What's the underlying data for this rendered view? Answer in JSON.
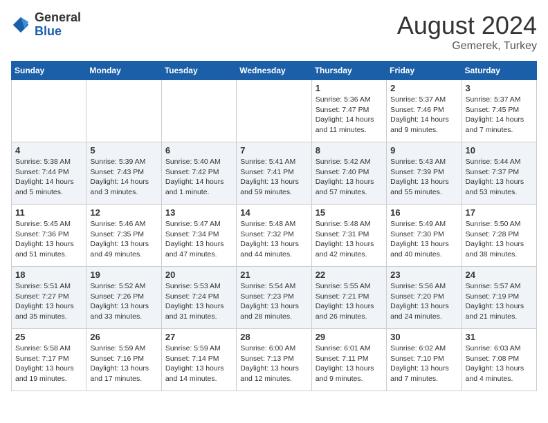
{
  "logo": {
    "general": "General",
    "blue": "Blue"
  },
  "title": {
    "month_year": "August 2024",
    "location": "Gemerek, Turkey"
  },
  "weekdays": [
    "Sunday",
    "Monday",
    "Tuesday",
    "Wednesday",
    "Thursday",
    "Friday",
    "Saturday"
  ],
  "weeks": [
    [
      {
        "day": "",
        "info": ""
      },
      {
        "day": "",
        "info": ""
      },
      {
        "day": "",
        "info": ""
      },
      {
        "day": "",
        "info": ""
      },
      {
        "day": "1",
        "info": "Sunrise: 5:36 AM\nSunset: 7:47 PM\nDaylight: 14 hours\nand 11 minutes."
      },
      {
        "day": "2",
        "info": "Sunrise: 5:37 AM\nSunset: 7:46 PM\nDaylight: 14 hours\nand 9 minutes."
      },
      {
        "day": "3",
        "info": "Sunrise: 5:37 AM\nSunset: 7:45 PM\nDaylight: 14 hours\nand 7 minutes."
      }
    ],
    [
      {
        "day": "4",
        "info": "Sunrise: 5:38 AM\nSunset: 7:44 PM\nDaylight: 14 hours\nand 5 minutes."
      },
      {
        "day": "5",
        "info": "Sunrise: 5:39 AM\nSunset: 7:43 PM\nDaylight: 14 hours\nand 3 minutes."
      },
      {
        "day": "6",
        "info": "Sunrise: 5:40 AM\nSunset: 7:42 PM\nDaylight: 14 hours\nand 1 minute."
      },
      {
        "day": "7",
        "info": "Sunrise: 5:41 AM\nSunset: 7:41 PM\nDaylight: 13 hours\nand 59 minutes."
      },
      {
        "day": "8",
        "info": "Sunrise: 5:42 AM\nSunset: 7:40 PM\nDaylight: 13 hours\nand 57 minutes."
      },
      {
        "day": "9",
        "info": "Sunrise: 5:43 AM\nSunset: 7:39 PM\nDaylight: 13 hours\nand 55 minutes."
      },
      {
        "day": "10",
        "info": "Sunrise: 5:44 AM\nSunset: 7:37 PM\nDaylight: 13 hours\nand 53 minutes."
      }
    ],
    [
      {
        "day": "11",
        "info": "Sunrise: 5:45 AM\nSunset: 7:36 PM\nDaylight: 13 hours\nand 51 minutes."
      },
      {
        "day": "12",
        "info": "Sunrise: 5:46 AM\nSunset: 7:35 PM\nDaylight: 13 hours\nand 49 minutes."
      },
      {
        "day": "13",
        "info": "Sunrise: 5:47 AM\nSunset: 7:34 PM\nDaylight: 13 hours\nand 47 minutes."
      },
      {
        "day": "14",
        "info": "Sunrise: 5:48 AM\nSunset: 7:32 PM\nDaylight: 13 hours\nand 44 minutes."
      },
      {
        "day": "15",
        "info": "Sunrise: 5:48 AM\nSunset: 7:31 PM\nDaylight: 13 hours\nand 42 minutes."
      },
      {
        "day": "16",
        "info": "Sunrise: 5:49 AM\nSunset: 7:30 PM\nDaylight: 13 hours\nand 40 minutes."
      },
      {
        "day": "17",
        "info": "Sunrise: 5:50 AM\nSunset: 7:28 PM\nDaylight: 13 hours\nand 38 minutes."
      }
    ],
    [
      {
        "day": "18",
        "info": "Sunrise: 5:51 AM\nSunset: 7:27 PM\nDaylight: 13 hours\nand 35 minutes."
      },
      {
        "day": "19",
        "info": "Sunrise: 5:52 AM\nSunset: 7:26 PM\nDaylight: 13 hours\nand 33 minutes."
      },
      {
        "day": "20",
        "info": "Sunrise: 5:53 AM\nSunset: 7:24 PM\nDaylight: 13 hours\nand 31 minutes."
      },
      {
        "day": "21",
        "info": "Sunrise: 5:54 AM\nSunset: 7:23 PM\nDaylight: 13 hours\nand 28 minutes."
      },
      {
        "day": "22",
        "info": "Sunrise: 5:55 AM\nSunset: 7:21 PM\nDaylight: 13 hours\nand 26 minutes."
      },
      {
        "day": "23",
        "info": "Sunrise: 5:56 AM\nSunset: 7:20 PM\nDaylight: 13 hours\nand 24 minutes."
      },
      {
        "day": "24",
        "info": "Sunrise: 5:57 AM\nSunset: 7:19 PM\nDaylight: 13 hours\nand 21 minutes."
      }
    ],
    [
      {
        "day": "25",
        "info": "Sunrise: 5:58 AM\nSunset: 7:17 PM\nDaylight: 13 hours\nand 19 minutes."
      },
      {
        "day": "26",
        "info": "Sunrise: 5:59 AM\nSunset: 7:16 PM\nDaylight: 13 hours\nand 17 minutes."
      },
      {
        "day": "27",
        "info": "Sunrise: 5:59 AM\nSunset: 7:14 PM\nDaylight: 13 hours\nand 14 minutes."
      },
      {
        "day": "28",
        "info": "Sunrise: 6:00 AM\nSunset: 7:13 PM\nDaylight: 13 hours\nand 12 minutes."
      },
      {
        "day": "29",
        "info": "Sunrise: 6:01 AM\nSunset: 7:11 PM\nDaylight: 13 hours\nand 9 minutes."
      },
      {
        "day": "30",
        "info": "Sunrise: 6:02 AM\nSunset: 7:10 PM\nDaylight: 13 hours\nand 7 minutes."
      },
      {
        "day": "31",
        "info": "Sunrise: 6:03 AM\nSunset: 7:08 PM\nDaylight: 13 hours\nand 4 minutes."
      }
    ]
  ]
}
